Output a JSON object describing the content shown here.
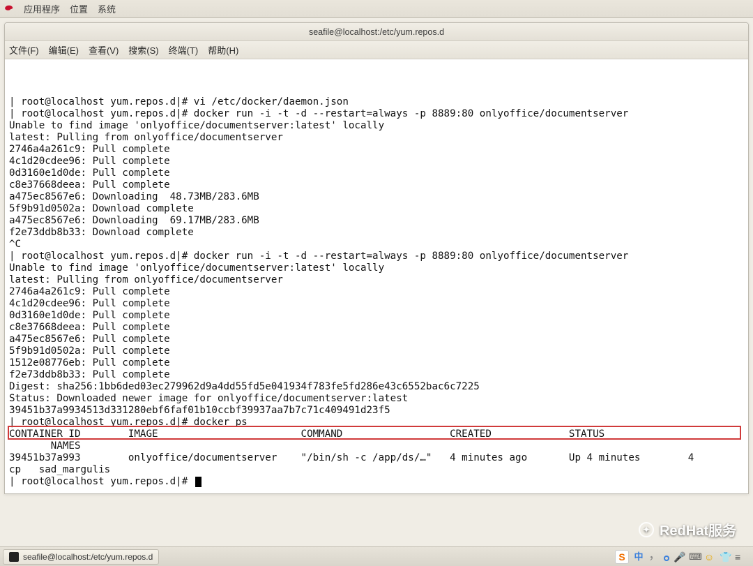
{
  "panel": {
    "apps": "应用程序",
    "places": "位置",
    "system": "系统"
  },
  "window": {
    "title": "seafile@localhost:/etc/yum.repos.d"
  },
  "menubar": {
    "file": "文件(F)",
    "edit": "编辑(E)",
    "view": "查看(V)",
    "search": "搜索(S)",
    "terminal": "终端(T)",
    "help": "帮助(H)"
  },
  "terminal": {
    "lines": [
      "| root@localhost yum.repos.d|# vi /etc/docker/daemon.json",
      "| root@localhost yum.repos.d|# docker run -i -t -d --restart=always -p 8889:80 onlyoffice/documentserver",
      "Unable to find image 'onlyoffice/documentserver:latest' locally",
      "latest: Pulling from onlyoffice/documentserver",
      "2746a4a261c9: Pull complete",
      "4c1d20cdee96: Pull complete",
      "0d3160e1d0de: Pull complete",
      "c8e37668deea: Pull complete",
      "a475ec8567e6: Downloading  48.73MB/283.6MB",
      "5f9b91d0502a: Download complete",
      "a475ec8567e6: Downloading  69.17MB/283.6MB",
      "f2e73ddb8b33: Download complete",
      "",
      "^C",
      "| root@localhost yum.repos.d|# docker run -i -t -d --restart=always -p 8889:80 onlyoffice/documentserver",
      "Unable to find image 'onlyoffice/documentserver:latest' locally",
      "latest: Pulling from onlyoffice/documentserver",
      "2746a4a261c9: Pull complete",
      "4c1d20cdee96: Pull complete",
      "0d3160e1d0de: Pull complete",
      "c8e37668deea: Pull complete",
      "a475ec8567e6: Pull complete",
      "5f9b91d0502a: Pull complete",
      "1512e08776eb: Pull complete",
      "f2e73ddb8b33: Pull complete",
      "Digest: sha256:1bb6ded03ec279962d9a4dd55fd5e041934f783fe5fd286e43c6552bac6c7225",
      "Status: Downloaded newer image for onlyoffice/documentserver:latest",
      "39451b37a9934513d331280ebf6faf01b10ccbf39937aa7b7c71c409491d23f5",
      "| root@localhost yum.repos.d|# docker ps",
      "CONTAINER ID        IMAGE                        COMMAND                  CREATED             STATUS",
      "       NAMES",
      "39451b37a993        onlyoffice/documentserver    \"/bin/sh -c /app/ds/…\"   4 minutes ago       Up 4 minutes        4",
      "cp   sad_margulis",
      "| root@localhost yum.repos.d|# "
    ]
  },
  "taskbar": {
    "task1": "seafile@localhost:/etc/yum.repos.d"
  },
  "tray": {
    "zh": "中"
  },
  "watermark": {
    "text": "RedHat服务"
  }
}
